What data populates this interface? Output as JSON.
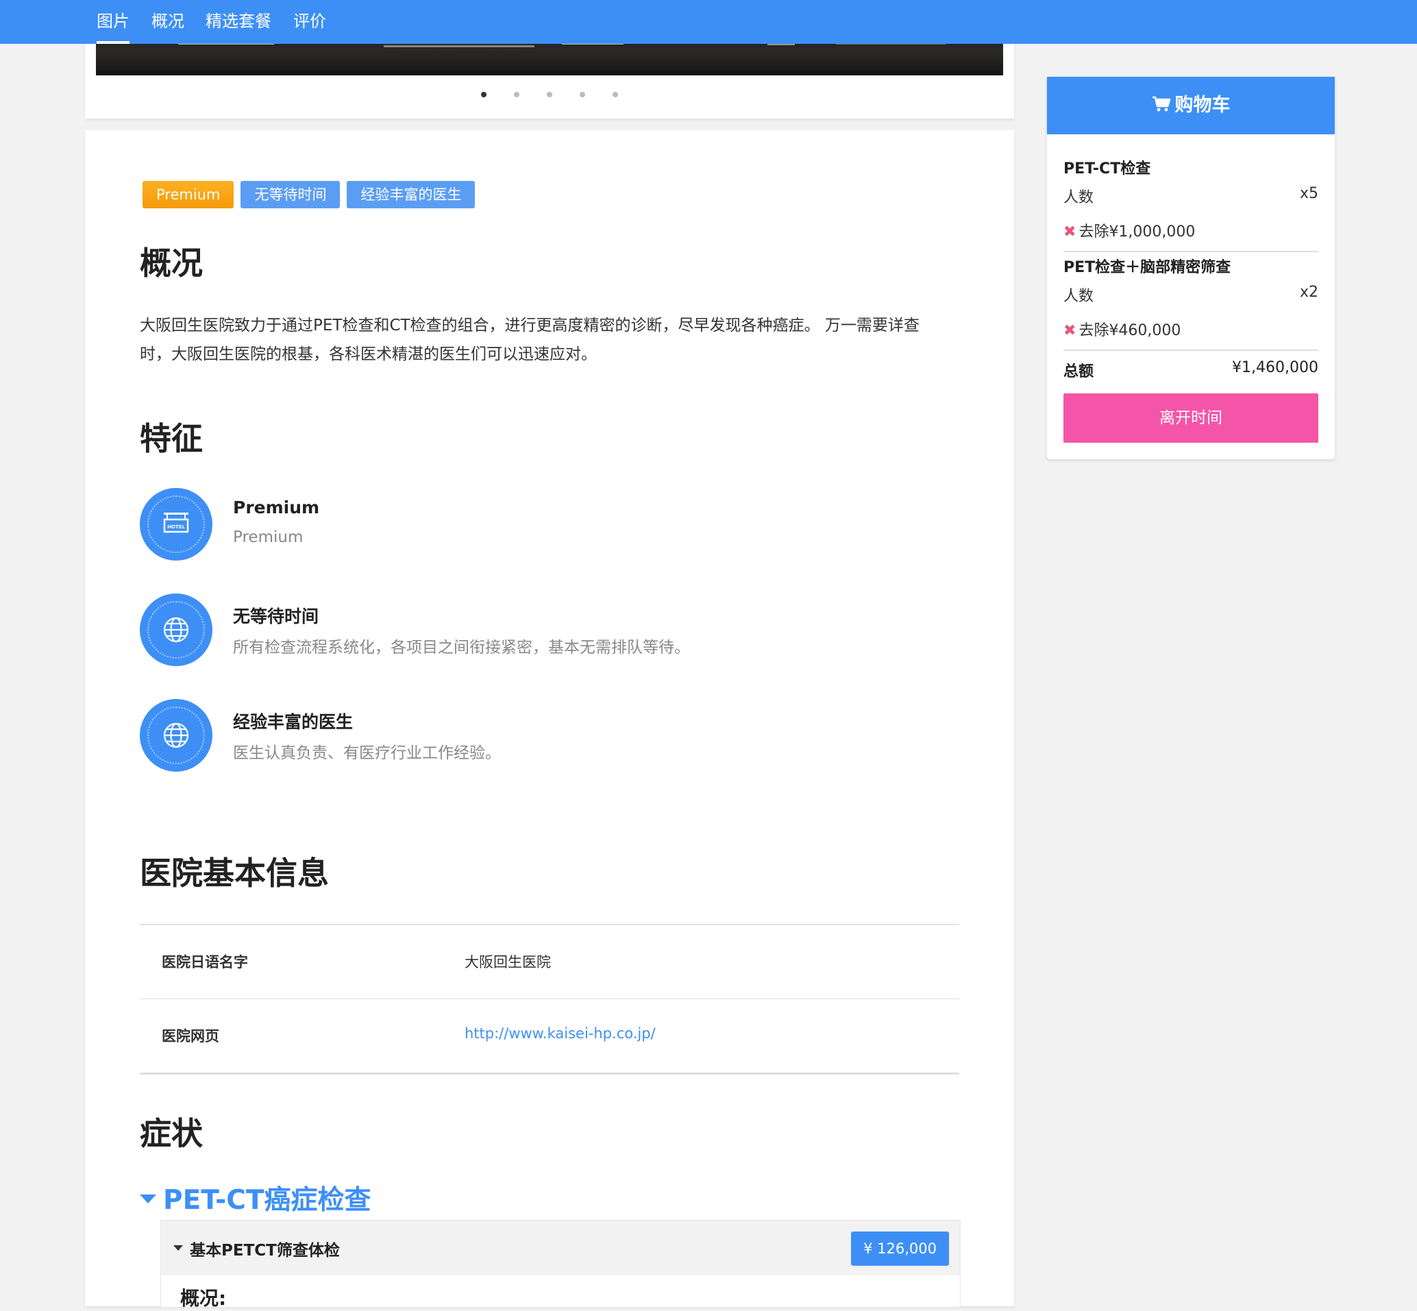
{
  "nav": {
    "tabs": [
      {
        "label": "图片"
      },
      {
        "label": "概况"
      },
      {
        "label": "精选套餐"
      },
      {
        "label": "评价"
      }
    ]
  },
  "gallery": {
    "slide_count": 5,
    "active_slide": 1
  },
  "badges": [
    "Premium",
    "无等待时间",
    "经验丰富的医生"
  ],
  "overview": {
    "heading": "概况",
    "text": "大阪回生医院致力于通过PET检查和CT检查的组合，进行更高度精密的诊断，尽早发现各种癌症。 万一需要详查时，大阪回生医院的根基，各科医术精湛的医生们可以迅速应对。"
  },
  "features": {
    "heading": "特征",
    "items": [
      {
        "icon": "hotel-sign-icon",
        "title": "Premium",
        "desc": "Premium"
      },
      {
        "icon": "globe-icon",
        "title": "无等待时间",
        "desc": "所有检查流程系统化，各项目之间衔接紧密，基本无需排队等待。"
      },
      {
        "icon": "globe-icon",
        "title": "经验丰富的医生",
        "desc": "医生认真负责、有医疗行业工作经验。"
      }
    ]
  },
  "hospital_info": {
    "heading": "医院基本信息",
    "rows": [
      {
        "key": "医院日语名字",
        "value": "大阪回生医院"
      },
      {
        "key": "医院网页",
        "value": "http://www.kaisei-hp.co.jp/"
      }
    ]
  },
  "symptoms": {
    "heading": "症状",
    "category": "PET-CT癌症检查",
    "plan": {
      "name": "基本PETCT筛查体检",
      "price": "¥ 126,000",
      "sub_heading": "概况:"
    }
  },
  "cart": {
    "title": "购物车",
    "items": [
      {
        "name": "PET-CT检查",
        "people_label": "人数",
        "qty": "x5",
        "remove": "去除¥1,000,000"
      },
      {
        "name": "PET检查＋脑部精密筛查",
        "people_label": "人数",
        "qty": "x2",
        "remove": "去除¥460,000"
      }
    ],
    "total_label": "总额",
    "total_value": "¥1,460,000",
    "checkout_label": "离开时间"
  },
  "colors": {
    "primary": "#3d8ff6",
    "premium_badge": "#f7a215",
    "checkout": "#f555a8",
    "remove_x": "#e8547a"
  }
}
